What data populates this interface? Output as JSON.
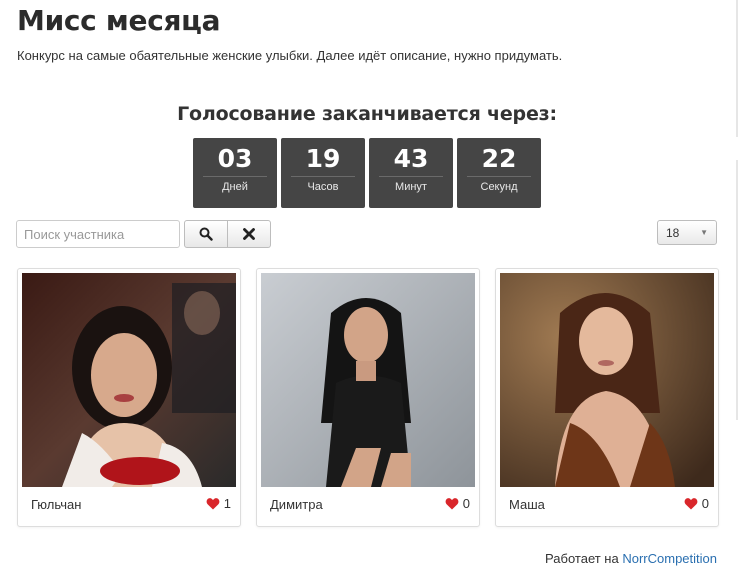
{
  "page": {
    "title": "Мисс месяца",
    "description": "Конкурс на самые обаятельные женские улыбки. Далее идёт описание, нужно придумать."
  },
  "countdown": {
    "heading": "Голосование заканчивается через:",
    "units": [
      {
        "value": "03",
        "label": "Дней"
      },
      {
        "value": "19",
        "label": "Часов"
      },
      {
        "value": "43",
        "label": "Минут"
      },
      {
        "value": "22",
        "label": "Секунд"
      }
    ]
  },
  "search": {
    "placeholder": "Поиск участника",
    "value": "",
    "search_icon": "search-icon",
    "clear_icon": "close-icon"
  },
  "page_size": {
    "selected": "18"
  },
  "participants": [
    {
      "name": "Гюльчан",
      "likes": "1"
    },
    {
      "name": "Димитра",
      "likes": "0"
    },
    {
      "name": "Маша",
      "likes": "0"
    }
  ],
  "footer": {
    "prefix": "Работает на",
    "link": "NorrCompetition"
  },
  "colors": {
    "timer_bg": "#454545",
    "heart": "#d9262b",
    "link": "#2a6fb0"
  }
}
